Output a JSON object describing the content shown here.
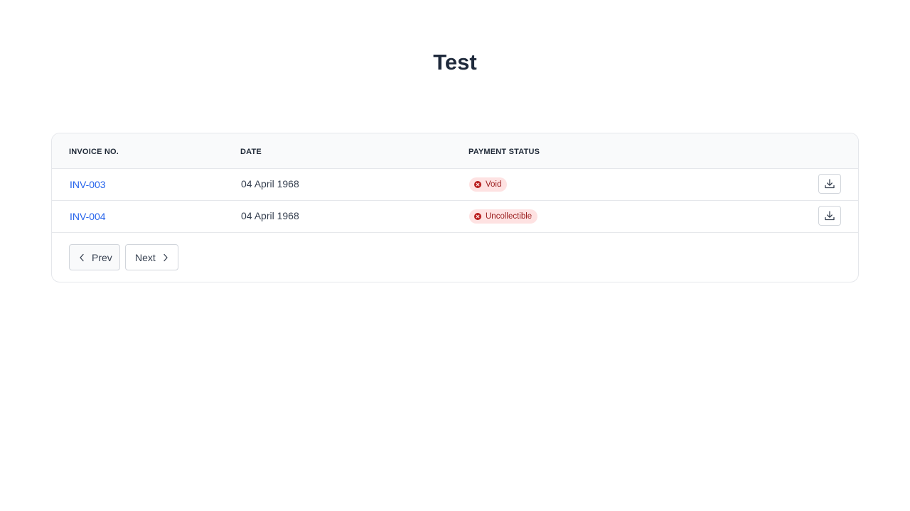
{
  "page": {
    "title": "Test"
  },
  "table": {
    "headers": {
      "invoice": "INVOICE NO.",
      "date": "DATE",
      "status": "PAYMENT STATUS"
    },
    "rows": [
      {
        "invoice": "INV-003",
        "date": "04 April 1968",
        "status": "Void",
        "status_icon": "x-circle-icon",
        "action_icon": "download-icon"
      },
      {
        "invoice": "INV-004",
        "date": "04 April 1968",
        "status": "Uncollectible",
        "status_icon": "x-circle-icon",
        "action_icon": "download-icon"
      }
    ]
  },
  "pagination": {
    "prev_label": "Prev",
    "next_label": "Next"
  },
  "colors": {
    "title": "#1e293b",
    "link": "#2563eb",
    "badge_bg": "#fee2e2",
    "badge_text": "#991b1b",
    "border": "#e5e7eb",
    "header_bg": "#f9fafb"
  }
}
